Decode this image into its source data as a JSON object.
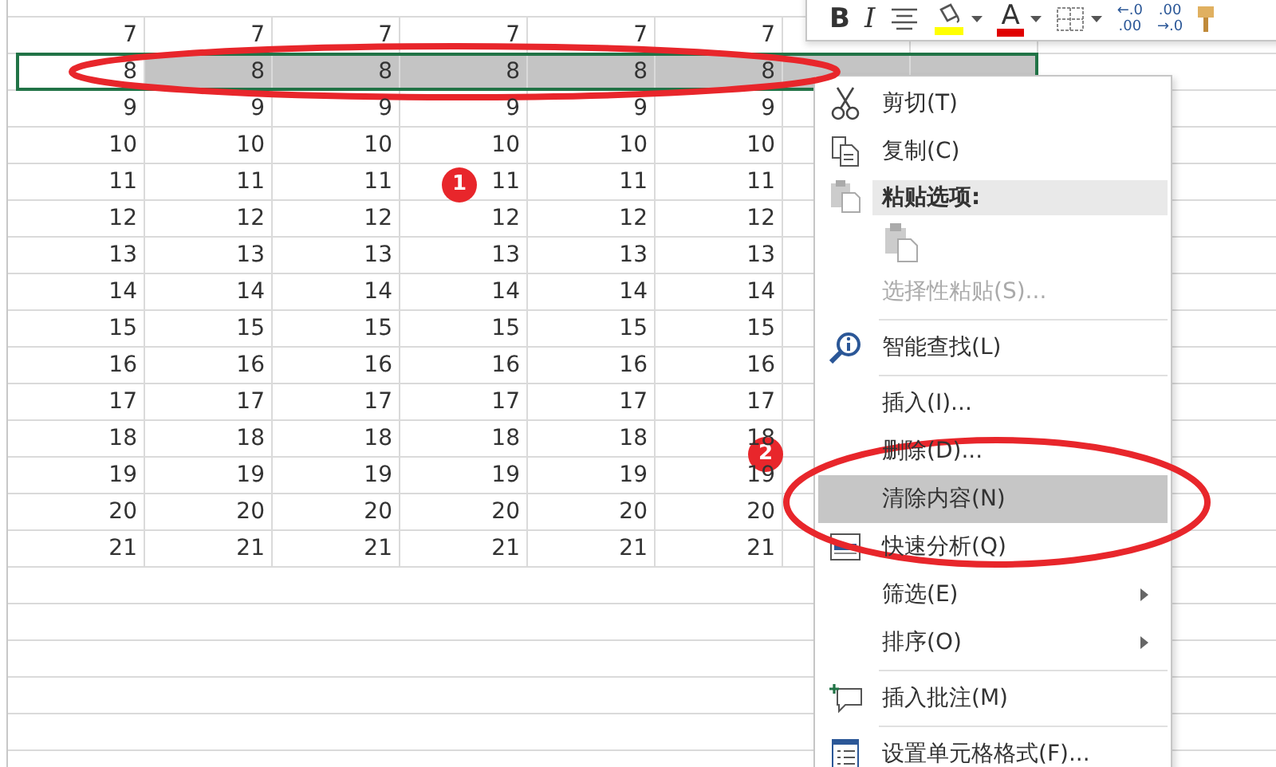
{
  "toolbar": [
    {
      "kind": "bold",
      "label": "B"
    },
    {
      "kind": "italic",
      "label": "I"
    },
    {
      "kind": "align"
    },
    {
      "kind": "fill_color",
      "dropdown": true
    },
    {
      "kind": "font_color",
      "label": "A",
      "dropdown": true
    },
    {
      "kind": "borders",
      "dropdown": true
    },
    {
      "kind": "increase_decimal",
      "lines": [
        "←.0",
        ".00"
      ]
    },
    {
      "kind": "decrease_decimal",
      "lines": [
        ".00",
        "→.0"
      ]
    },
    {
      "kind": "format_painter"
    }
  ],
  "sheet": {
    "rows": [
      {
        "selected": false,
        "cells": [
          "7",
          "7",
          "7",
          "7",
          "7",
          "7"
        ]
      },
      {
        "selected": true,
        "cells": [
          "8",
          "8",
          "8",
          "8",
          "8",
          "8"
        ]
      },
      {
        "selected": false,
        "cells": [
          "9",
          "9",
          "9",
          "9",
          "9",
          "9"
        ]
      },
      {
        "selected": false,
        "cells": [
          "10",
          "10",
          "10",
          "10",
          "10",
          "10"
        ]
      },
      {
        "selected": false,
        "cells": [
          "11",
          "11",
          "11",
          "11",
          "11",
          "11"
        ]
      },
      {
        "selected": false,
        "cells": [
          "12",
          "12",
          "12",
          "12",
          "12",
          "12"
        ]
      },
      {
        "selected": false,
        "cells": [
          "13",
          "13",
          "13",
          "13",
          "13",
          "13"
        ]
      },
      {
        "selected": false,
        "cells": [
          "14",
          "14",
          "14",
          "14",
          "14",
          "14"
        ]
      },
      {
        "selected": false,
        "cells": [
          "15",
          "15",
          "15",
          "15",
          "15",
          "15"
        ]
      },
      {
        "selected": false,
        "cells": [
          "16",
          "16",
          "16",
          "16",
          "16",
          "16"
        ]
      },
      {
        "selected": false,
        "cells": [
          "17",
          "17",
          "17",
          "17",
          "17",
          "17"
        ]
      },
      {
        "selected": false,
        "cells": [
          "18",
          "18",
          "18",
          "18",
          "18",
          "18"
        ]
      },
      {
        "selected": false,
        "cells": [
          "19",
          "19",
          "19",
          "19",
          "19",
          "19"
        ]
      },
      {
        "selected": false,
        "cells": [
          "20",
          "20",
          "20",
          "20",
          "20",
          "20"
        ]
      },
      {
        "selected": false,
        "cells": [
          "21",
          "21",
          "21",
          "21",
          "21",
          "21"
        ]
      }
    ]
  },
  "context_menu": [
    {
      "kind": "item",
      "label": "剪切(T)",
      "disabled": false,
      "highlighted": false,
      "submenu": false
    },
    {
      "kind": "item",
      "label": "复制(C)",
      "disabled": false,
      "highlighted": false,
      "submenu": false
    },
    {
      "kind": "header",
      "label": "粘贴选项:"
    },
    {
      "kind": "paste_options"
    },
    {
      "kind": "item",
      "label": "选择性粘贴(S)...",
      "disabled": true,
      "highlighted": false,
      "submenu": false
    },
    {
      "kind": "separator"
    },
    {
      "kind": "item",
      "label": "智能查找(L)",
      "disabled": false,
      "highlighted": false,
      "submenu": false
    },
    {
      "kind": "separator"
    },
    {
      "kind": "item",
      "label": "插入(I)...",
      "disabled": false,
      "highlighted": false,
      "submenu": false
    },
    {
      "kind": "item",
      "label": "删除(D)...",
      "disabled": false,
      "highlighted": false,
      "submenu": false
    },
    {
      "kind": "item",
      "label": "清除内容(N)",
      "disabled": false,
      "highlighted": true,
      "submenu": false
    },
    {
      "kind": "item",
      "label": "快速分析(Q)",
      "disabled": false,
      "highlighted": false,
      "submenu": false
    },
    {
      "kind": "item",
      "label": "筛选(E)",
      "disabled": false,
      "highlighted": false,
      "submenu": true
    },
    {
      "kind": "item",
      "label": "排序(O)",
      "disabled": false,
      "highlighted": false,
      "submenu": true
    },
    {
      "kind": "separator"
    },
    {
      "kind": "item",
      "label": "插入批注(M)",
      "disabled": false,
      "highlighted": false,
      "submenu": false
    },
    {
      "kind": "separator"
    },
    {
      "kind": "item",
      "label": "设置单元格格式(F)...",
      "disabled": false,
      "highlighted": false,
      "submenu": false
    }
  ],
  "annotations": [
    {
      "label": "1"
    },
    {
      "label": "2"
    }
  ]
}
